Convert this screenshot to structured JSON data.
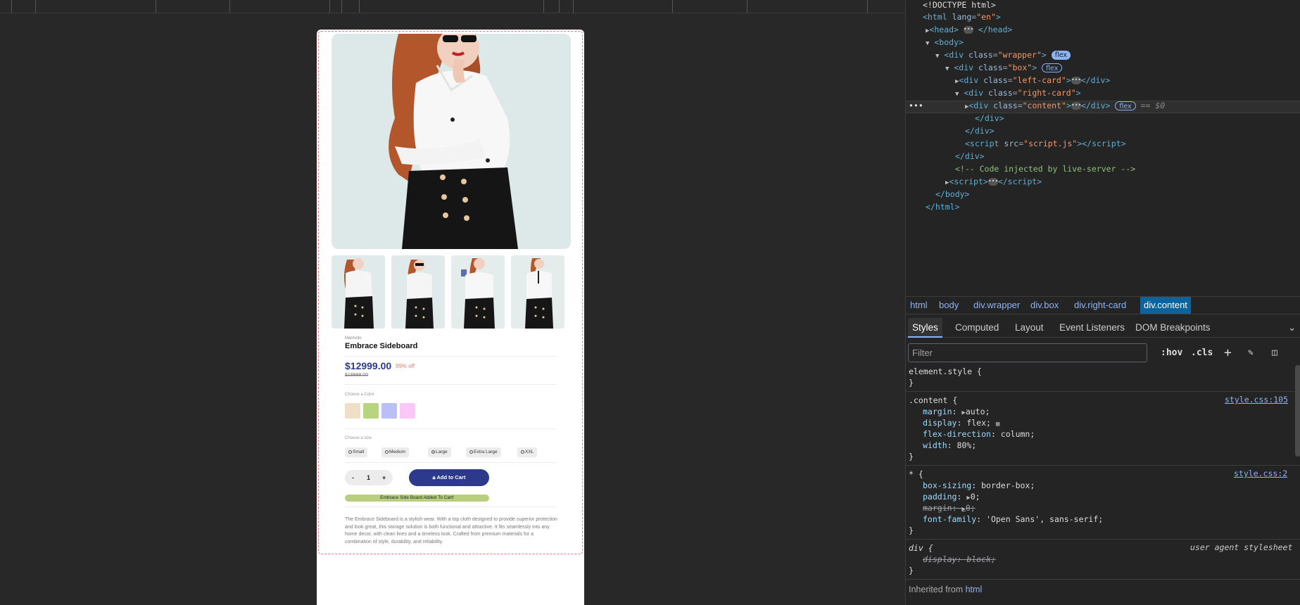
{
  "product": {
    "brand": "Marmoto",
    "title": "Embrace Sideboard",
    "price": "$12999.00",
    "discount": "99% off",
    "old_price": "$19999.00",
    "color_label": "Choose a Color",
    "colors": [
      "#efdec8",
      "#b7d47e",
      "#babff6",
      "#fbc7f6"
    ],
    "size_label": "Choose a size",
    "sizes": [
      "Small",
      "Medium",
      "Large",
      "Extra Large",
      "XXL"
    ],
    "selected_size": "Large",
    "qty_minus": "-",
    "qty_value": "1",
    "qty_plus": "+",
    "cart_button": "Add to Cart",
    "toast": "Embrace Side Board Added To Cart!",
    "description": "The Embrace Sideboard is a stylish wear. With a top cloth designed to provide superior protection and look great, this storage solution is both functional and attractive. It fits seamlessly into any home decor, with clean lines and a timeless look. Crafted from premium materials for a combination of style, durability, and reliability."
  },
  "dom": {
    "doctype": "<!DOCTYPE html>",
    "dollar": "== $0",
    "comment": "<!-- Code injected by live-server -->",
    "script_src": "script.js"
  },
  "breadcrumbs": [
    "html",
    "body",
    "div.wrapper",
    "div.box",
    "div.right-card",
    "div.content"
  ],
  "tabs": [
    "Styles",
    "Computed",
    "Layout",
    "Event Listeners",
    "DOM Breakpoints"
  ],
  "filter_placeholder": "Filter",
  "tools": {
    "hov": ":hov",
    "cls": ".cls"
  },
  "styles": {
    "element_style": "element.style {",
    "content_selector": ".content {",
    "content_src": "style.css:105",
    "content_props": [
      {
        "name": "margin",
        "value": "auto;"
      },
      {
        "name": "display",
        "value": "flex;"
      },
      {
        "name": "flex-direction",
        "value": "column;"
      },
      {
        "name": "width",
        "value": "80%;"
      }
    ],
    "star_selector": "* {",
    "star_src": "style.css:2",
    "star_props": [
      {
        "name": "box-sizing",
        "value": "border-box;"
      },
      {
        "name": "padding",
        "value": "0;"
      },
      {
        "name": "margin",
        "value": "0;"
      },
      {
        "name": "font-family",
        "value": "'Open Sans', sans-serif;"
      }
    ],
    "div_selector": "div {",
    "div_src": "user agent stylesheet",
    "div_prop": "display: block;",
    "inherited_label": "Inherited from",
    "inherited_from": "html"
  }
}
